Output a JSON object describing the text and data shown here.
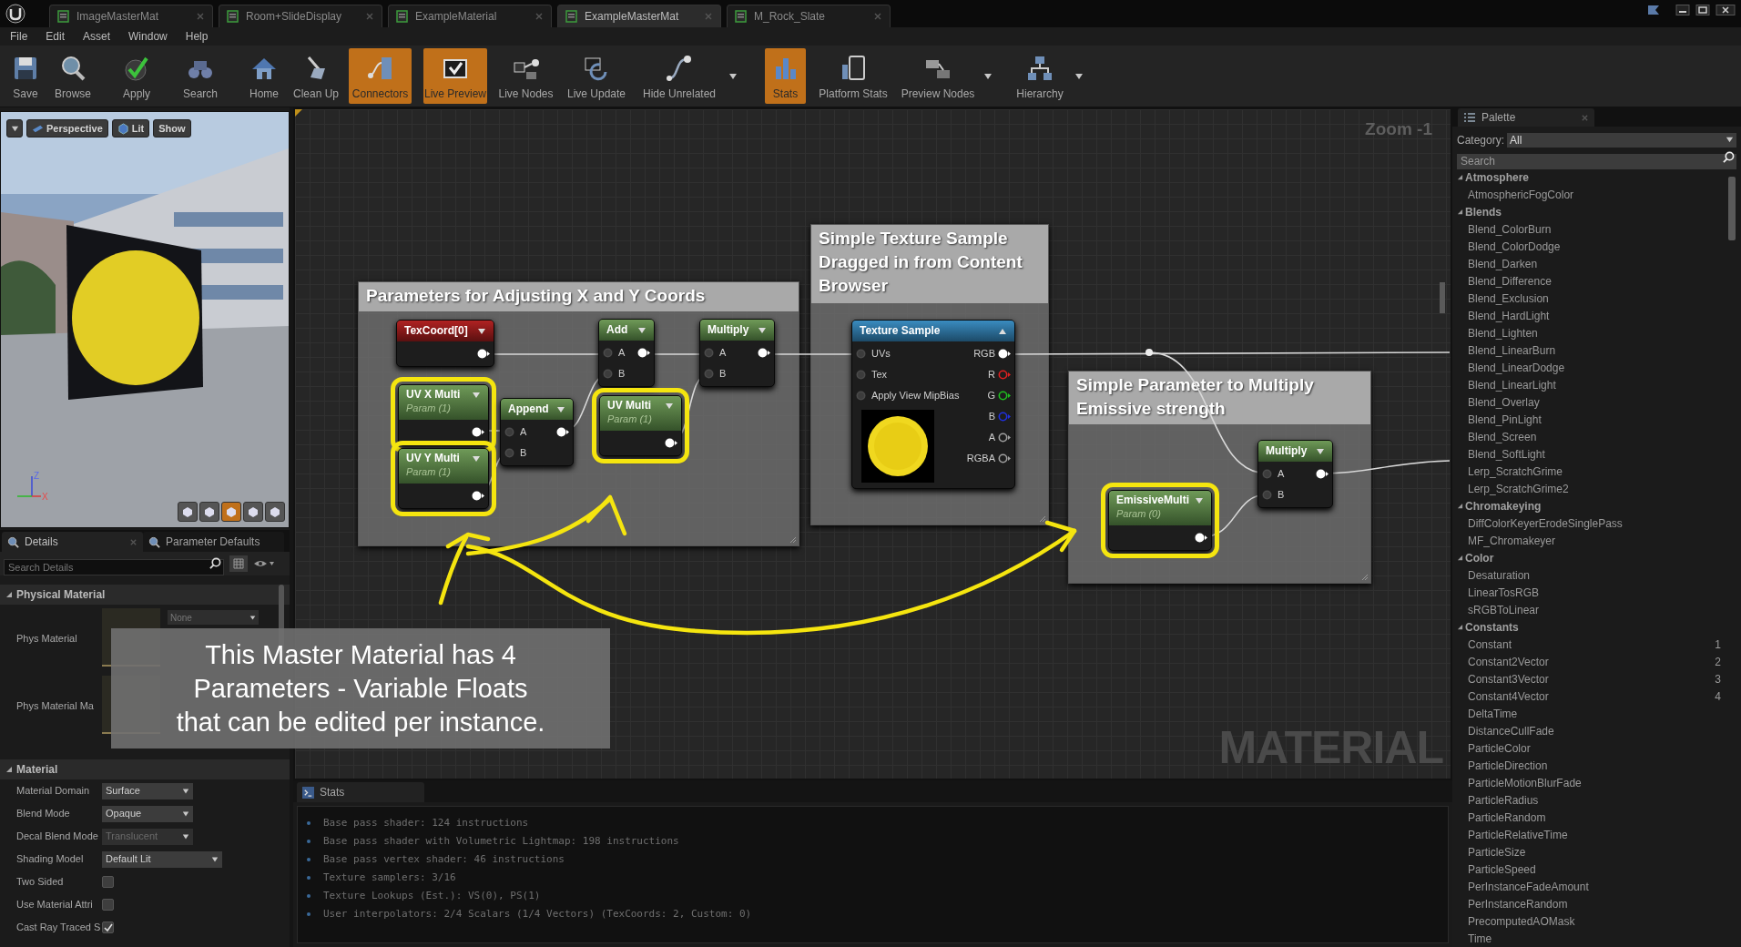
{
  "editor_tabs": [
    {
      "label": "ImageMasterMat",
      "selected": false
    },
    {
      "label": "Room+SlideDisplay",
      "selected": false
    },
    {
      "label": "ExampleMaterial",
      "selected": false
    },
    {
      "label": "ExampleMasterMat",
      "selected": true
    },
    {
      "label": "M_Rock_Slate",
      "selected": false
    }
  ],
  "menu": [
    "File",
    "Edit",
    "Asset",
    "Window",
    "Help"
  ],
  "toolbar": [
    {
      "label": "Save",
      "active": false,
      "has_menu": false
    },
    {
      "label": "Browse",
      "active": false,
      "has_menu": false
    },
    {
      "label": "Apply",
      "active": false,
      "has_menu": false
    },
    {
      "label": "Search",
      "active": false,
      "has_menu": false
    },
    {
      "label": "Home",
      "active": false,
      "has_menu": false
    },
    {
      "label": "Clean Up",
      "active": false,
      "has_menu": false
    },
    {
      "label": "Connectors",
      "active": true,
      "has_menu": false
    },
    {
      "label": "Live Preview",
      "active": true,
      "has_menu": false
    },
    {
      "label": "Live Nodes",
      "active": false,
      "has_menu": false
    },
    {
      "label": "Live Update",
      "active": false,
      "has_menu": false
    },
    {
      "label": "Hide Unrelated",
      "active": false,
      "has_menu": true
    },
    {
      "label": "Stats",
      "active": true,
      "has_menu": false
    },
    {
      "label": "Platform Stats",
      "active": false,
      "has_menu": false
    },
    {
      "label": "Preview Nodes",
      "active": false,
      "has_menu": true
    },
    {
      "label": "Hierarchy",
      "active": false,
      "has_menu": true
    }
  ],
  "viewport": {
    "buttons": [
      "Perspective",
      "Lit",
      "Show"
    ],
    "axis_labels": [
      "Z",
      "X"
    ],
    "view_modes": [
      {
        "selected": false
      },
      {
        "selected": false
      },
      {
        "selected": true
      },
      {
        "selected": false
      },
      {
        "selected": false
      }
    ]
  },
  "details": {
    "tabs": [
      {
        "label": "Details",
        "selected": true
      },
      {
        "label": "Parameter Defaults",
        "selected": false
      }
    ],
    "search": {
      "placeholder": "Search Details"
    },
    "sections": [
      {
        "title": "Physical Material",
        "expanded": true,
        "rows": [
          {
            "label": "Phys Material",
            "kind": "asset",
            "value": "None"
          },
          {
            "label": "Phys Material Ma",
            "kind": "asset"
          }
        ]
      },
      {
        "title": "Material",
        "expanded": true,
        "rows": [
          {
            "label": "Material Domain",
            "kind": "dropdown",
            "value": "Surface",
            "disabled": false
          },
          {
            "label": "Blend Mode",
            "kind": "dropdown",
            "value": "Opaque",
            "disabled": false
          },
          {
            "label": "Decal Blend Mode",
            "kind": "dropdown",
            "value": "Translucent",
            "disabled": true
          },
          {
            "label": "Shading Model",
            "kind": "dropdown",
            "value": "Default Lit",
            "disabled": false
          },
          {
            "label": "Two Sided",
            "kind": "checkbox",
            "checked": false
          },
          {
            "label": "Use Material Attri",
            "kind": "checkbox",
            "checked": false
          },
          {
            "label": "Cast Ray Traced S",
            "kind": "checkbox",
            "checked": true
          }
        ]
      }
    ]
  },
  "graph": {
    "zoom_label": "Zoom -1",
    "watermark": "MATERIAL",
    "comments": [
      {
        "title": "Parameters for Adjusting X and Y Coords"
      },
      {
        "title": "Simple Texture Sample Dragged in from Content Browser"
      },
      {
        "title": "Simple Parameter to Multiply Emissive strength"
      }
    ],
    "nodes": [
      {
        "title": "TexCoord[0]",
        "kind": "texcoord",
        "highlighted": false
      },
      {
        "title": "UV X Multi",
        "kind": "param",
        "subtitle": "Param (1)",
        "highlighted": true
      },
      {
        "title": "UV Y Multi",
        "kind": "param",
        "subtitle": "Param (1)",
        "highlighted": true
      },
      {
        "title": "Append",
        "kind": "math",
        "inputs": [
          "A",
          "B"
        ],
        "highlighted": false
      },
      {
        "title": "Add",
        "kind": "math",
        "inputs": [
          "A",
          "B"
        ],
        "highlighted": false
      },
      {
        "title": "UV Multi",
        "kind": "param",
        "subtitle": "Param (1)",
        "highlighted": true
      },
      {
        "title": "Multiply",
        "kind": "math",
        "inputs": [
          "A",
          "B"
        ],
        "highlighted": false
      },
      {
        "title": "Texture Sample",
        "kind": "texture",
        "inputs": [
          "UVs",
          "Tex",
          "Apply View MipBias"
        ],
        "outputs": [
          {
            "label": "RGB",
            "color": "#ffffff",
            "connected": true
          },
          {
            "label": "R",
            "color": "#e02020",
            "connected": false
          },
          {
            "label": "G",
            "color": "#20c020",
            "connected": false
          },
          {
            "label": "B",
            "color": "#2030e0",
            "connected": false
          },
          {
            "label": "A",
            "color": "#a0a0a0",
            "connected": false
          },
          {
            "label": "RGBA",
            "color": "#a0a0a0",
            "connected": false
          }
        ],
        "highlighted": false
      },
      {
        "title": "EmissiveMulti",
        "kind": "param",
        "subtitle": "Param (0)",
        "highlighted": true
      },
      {
        "title": "Multiply",
        "kind": "math",
        "inputs": [
          "A",
          "B"
        ],
        "highlighted": false
      }
    ]
  },
  "note": {
    "lines": [
      "This Master Material has 4",
      "Parameters - Variable Floats",
      "that can be edited per instance."
    ]
  },
  "stats": {
    "tab": "Stats",
    "lines": [
      "Base pass shader: 124 instructions",
      "Base pass shader with Volumetric Lightmap: 198 instructions",
      "Base pass vertex shader: 46 instructions",
      "Texture samplers: 3/16",
      "Texture Lookups (Est.): VS(0), PS(1)",
      "User interpolators: 2/4 Scalars (1/4 Vectors) (TexCoords: 2, Custom: 0)"
    ]
  },
  "palette": {
    "tab": "Palette",
    "category_label": "Category:",
    "category": "All",
    "search": {
      "placeholder": "Search"
    },
    "groups": [
      {
        "title": "Atmosphere",
        "expanded": true,
        "items": [
          {
            "label": "AtmosphericFogColor"
          }
        ]
      },
      {
        "title": "Blends",
        "expanded": true,
        "items": [
          {
            "label": "Blend_ColorBurn"
          },
          {
            "label": "Blend_ColorDodge"
          },
          {
            "label": "Blend_Darken"
          },
          {
            "label": "Blend_Difference"
          },
          {
            "label": "Blend_Exclusion"
          },
          {
            "label": "Blend_HardLight"
          },
          {
            "label": "Blend_Lighten"
          },
          {
            "label": "Blend_LinearBurn"
          },
          {
            "label": "Blend_LinearDodge"
          },
          {
            "label": "Blend_LinearLight"
          },
          {
            "label": "Blend_Overlay"
          },
          {
            "label": "Blend_PinLight"
          },
          {
            "label": "Blend_Screen"
          },
          {
            "label": "Blend_SoftLight"
          },
          {
            "label": "Lerp_ScratchGrime"
          },
          {
            "label": "Lerp_ScratchGrime2"
          }
        ]
      },
      {
        "title": "Chromakeying",
        "expanded": true,
        "items": [
          {
            "label": "DiffColorKeyerErodeSinglePass"
          },
          {
            "label": "MF_Chromakeyer"
          }
        ]
      },
      {
        "title": "Color",
        "expanded": true,
        "items": [
          {
            "label": "Desaturation"
          },
          {
            "label": "LinearTosRGB"
          },
          {
            "label": "sRGBToLinear"
          }
        ]
      },
      {
        "title": "Constants",
        "expanded": true,
        "items": [
          {
            "label": "Constant",
            "shortcut": "1"
          },
          {
            "label": "Constant2Vector",
            "shortcut": "2"
          },
          {
            "label": "Constant3Vector",
            "shortcut": "3"
          },
          {
            "label": "Constant4Vector",
            "shortcut": "4"
          },
          {
            "label": "DeltaTime"
          },
          {
            "label": "DistanceCullFade"
          },
          {
            "label": "ParticleColor"
          },
          {
            "label": "ParticleDirection"
          },
          {
            "label": "ParticleMotionBlurFade"
          },
          {
            "label": "ParticleRadius"
          },
          {
            "label": "ParticleRandom"
          },
          {
            "label": "ParticleRelativeTime"
          },
          {
            "label": "ParticleSize"
          },
          {
            "label": "ParticleSpeed"
          },
          {
            "label": "PerInstanceFadeAmount"
          },
          {
            "label": "PerInstanceRandom"
          },
          {
            "label": "PrecomputedAOMask"
          },
          {
            "label": "Time"
          }
        ]
      }
    ]
  }
}
